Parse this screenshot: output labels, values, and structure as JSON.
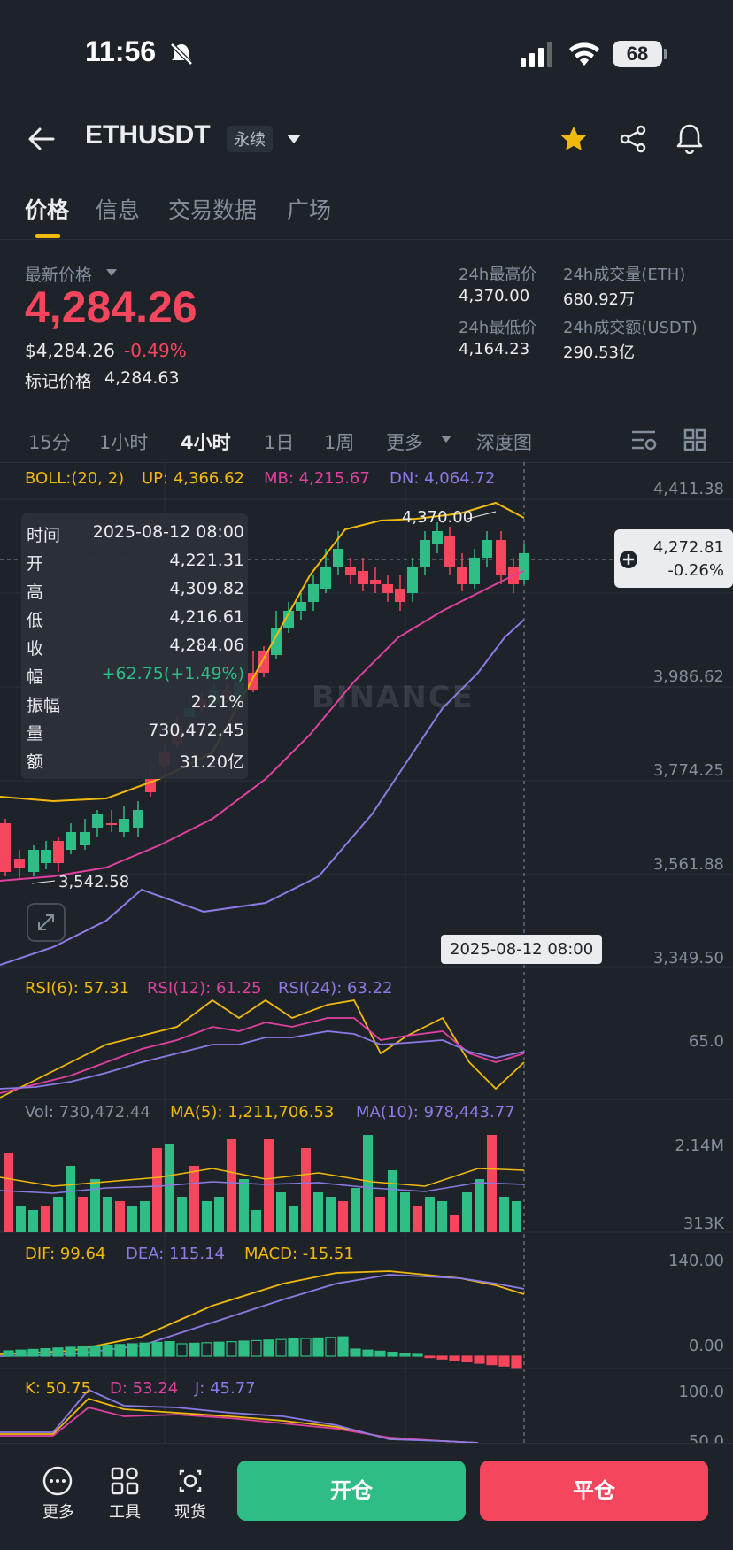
{
  "status": {
    "time": "11:56",
    "battery": "68"
  },
  "header": {
    "symbol": "ETHUSDT",
    "contract_type": "永续"
  },
  "tabs": [
    {
      "label": "价格"
    },
    {
      "label": "信息"
    },
    {
      "label": "交易数据"
    },
    {
      "label": "广场"
    }
  ],
  "price": {
    "last_label": "最新价格",
    "last": "4,284.26",
    "usd": "$4,284.26",
    "change_pct": "-0.49%",
    "mark_label": "标记价格",
    "mark": "4,284.63"
  },
  "stats": {
    "high_label": "24h最高价",
    "high": "4,370.00",
    "low_label": "24h最低价",
    "low": "4,164.23",
    "vol_eth_label": "24h成交量(ETH)",
    "vol_eth": "680.92万",
    "vol_usdt_label": "24h成交额(USDT)",
    "vol_usdt": "290.53亿"
  },
  "intervals": [
    {
      "label": "15分"
    },
    {
      "label": "1小时"
    },
    {
      "label": "4小时"
    },
    {
      "label": "1日"
    },
    {
      "label": "1周"
    },
    {
      "label": "更多"
    },
    {
      "label": "深度图"
    }
  ],
  "boll": {
    "label": "BOLL:(20, 2)",
    "up": "UP: 4,366.62",
    "mb": "MB: 4,215.67",
    "dn": "DN: 4,064.72"
  },
  "price_axis": [
    "4,411.38",
    "3,986.62",
    "3,774.25",
    "3,561.88",
    "3,349.50"
  ],
  "chart_marks": {
    "high": "4,370.00",
    "low": "3,542.58"
  },
  "price_tag": {
    "price": "4,272.81",
    "change": "-0.26%"
  },
  "crosshair_date": "2025-08-12 08:00",
  "watermark": "BINANCE",
  "tooltip": [
    {
      "k": "时间",
      "v": "2025-08-12 08:00"
    },
    {
      "k": "开",
      "v": "4,221.31"
    },
    {
      "k": "高",
      "v": "4,309.82"
    },
    {
      "k": "低",
      "v": "4,216.61"
    },
    {
      "k": "收",
      "v": "4,284.06"
    },
    {
      "k": "幅",
      "v": "+62.75(+1.49%)"
    },
    {
      "k": "振幅",
      "v": "2.21%"
    },
    {
      "k": "量",
      "v": "730,472.45"
    },
    {
      "k": "额",
      "v": "31.20亿"
    }
  ],
  "rsi": {
    "r6": "RSI(6): 57.31",
    "r12": "RSI(12): 61.25",
    "r24": "RSI(24): 63.22",
    "axis": "65.0"
  },
  "vol": {
    "vol": "Vol: 730,472.44",
    "ma5": "MA(5): 1,211,706.53",
    "ma10": "MA(10): 978,443.77",
    "axis_top": "2.14M",
    "axis_bottom": "313K"
  },
  "macd": {
    "dif": "DIF: 99.64",
    "dea": "DEA: 115.14",
    "macd": "MACD: -15.51",
    "axis_top": "140.00",
    "axis_bottom": "0.00"
  },
  "kdj": {
    "k": "K: 50.75",
    "d": "D: 53.24",
    "j": "J: 45.77",
    "axis_top": "100.0",
    "axis_mid": "50.0"
  },
  "bottom": {
    "more": "更多",
    "tools": "工具",
    "spot": "现货",
    "open": "开仓",
    "close": "平仓"
  },
  "colors": {
    "up": "#2ebd85",
    "down": "#f6465d",
    "accent": "#f0b90b",
    "boll_up": "#f0b90b",
    "boll_mb": "#e040a0",
    "boll_dn": "#8c7ae6"
  }
}
